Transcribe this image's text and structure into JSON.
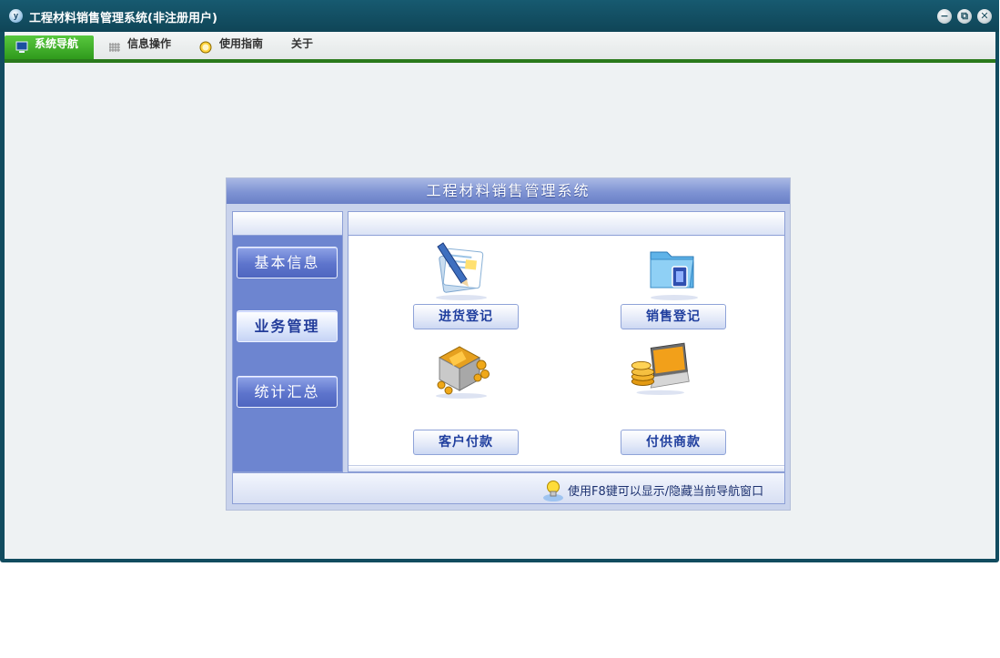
{
  "window": {
    "title": "工程材料销售管理系统(非注册用户)",
    "app_icon_letter": "y",
    "controls": {
      "minimize": "−",
      "restore": "⧉",
      "close": "✕"
    }
  },
  "menubar": {
    "items": [
      {
        "label": "系统导航",
        "icon": "monitor-icon",
        "active": true
      },
      {
        "label": "信息操作",
        "icon": "grid-icon",
        "active": false
      },
      {
        "label": "使用指南",
        "icon": "clock-icon",
        "active": false
      },
      {
        "label": "关于",
        "icon": "",
        "active": false
      }
    ]
  },
  "panel": {
    "title": "工程材料销售管理系统",
    "categories": [
      {
        "label": "基本信息",
        "selected": false
      },
      {
        "label": "业务管理",
        "selected": true
      },
      {
        "label": "统计汇总",
        "selected": false
      }
    ],
    "functions": [
      {
        "label": "进货登记",
        "icon": "pen-document-icon"
      },
      {
        "label": "销售登记",
        "icon": "blue-folder-icon"
      },
      {
        "label": "客户付款",
        "icon": "building-coins-icon"
      },
      {
        "label": "付供商款",
        "icon": "laptop-coins-icon"
      }
    ],
    "footer_tip": "使用F8键可以显示/隐藏当前导航窗口"
  },
  "colors": {
    "titlebar": "#114c5f",
    "menu_active": "#3fa82a",
    "panel_header": "#7e93d3",
    "category_bg": "#6d85d0"
  }
}
